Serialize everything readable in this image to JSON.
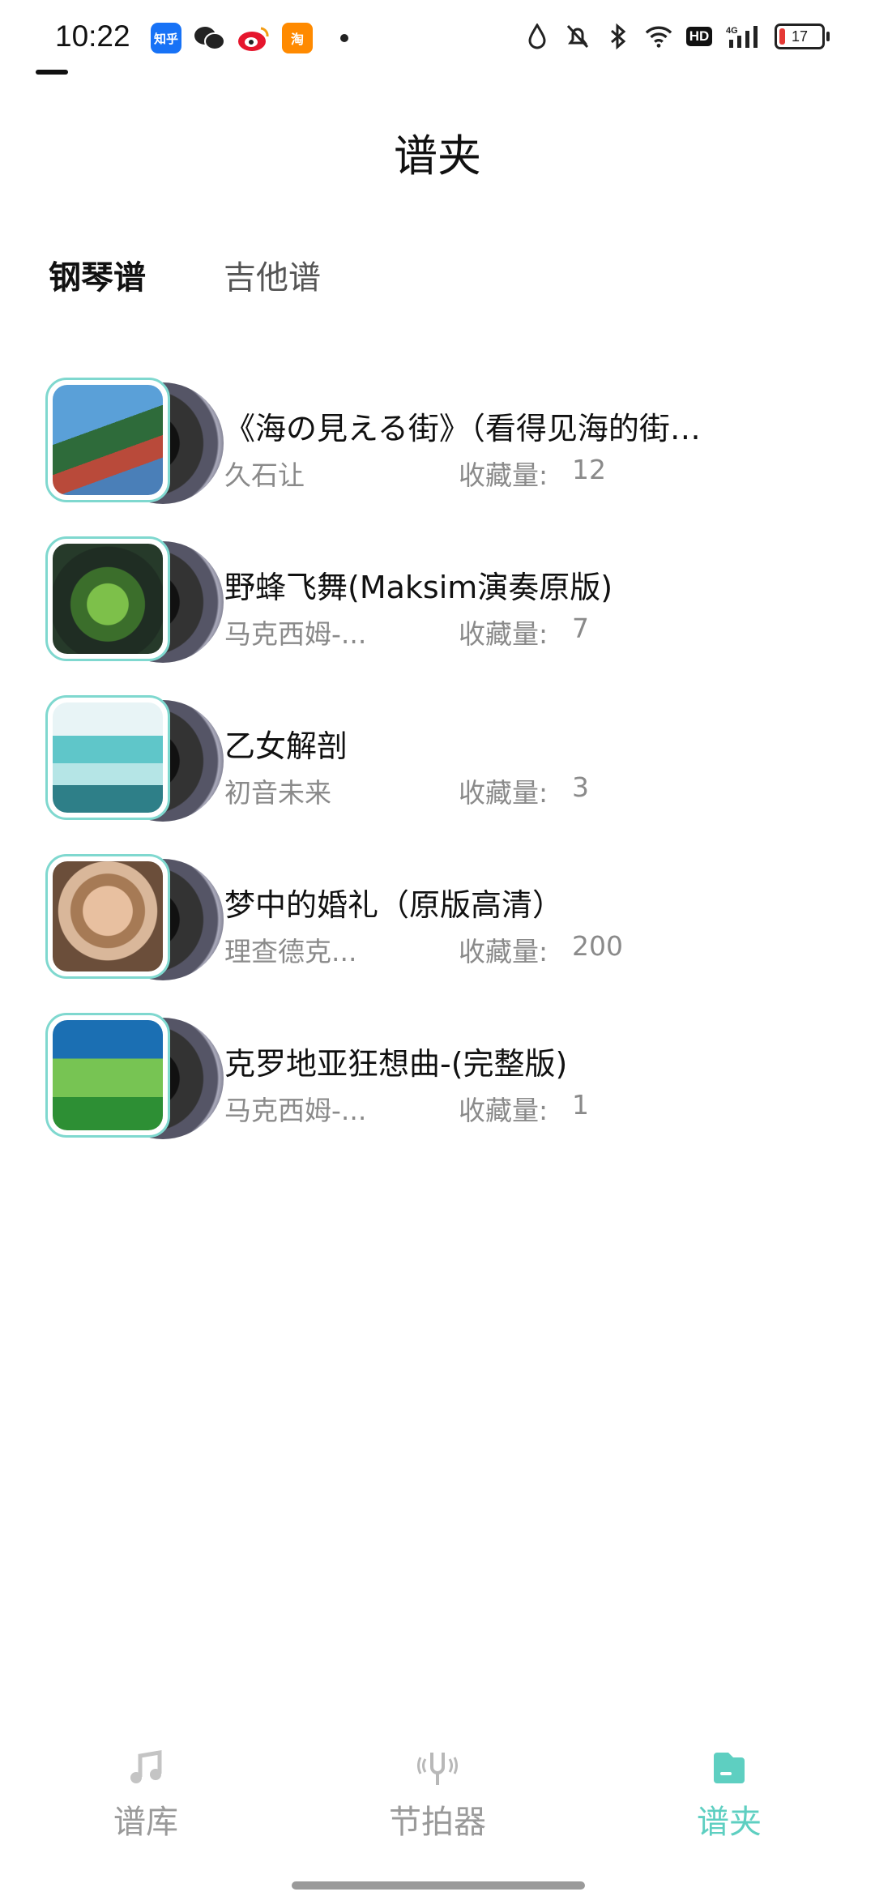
{
  "status_bar": {
    "time": "10:22",
    "apps": [
      "知乎",
      "微信",
      "微博",
      "淘宝"
    ],
    "zhihu_label": "知乎",
    "taobao_label": "淘",
    "hd_label": "HD",
    "network_label": "4G",
    "battery_level": "17"
  },
  "header": {
    "title": "谱夹"
  },
  "tabs": [
    {
      "label": "钢琴谱",
      "active": true
    },
    {
      "label": "吉他谱",
      "active": false
    }
  ],
  "favorites_label": "收藏量:",
  "items": [
    {
      "title": "《海の見える街》（看得见海的街…",
      "artist": "久石让",
      "count": "12"
    },
    {
      "title": "野蜂飞舞(Maksim演奏原版)",
      "artist": "马克西姆-...",
      "count": "7"
    },
    {
      "title": "乙女解剖",
      "artist": "初音未来",
      "count": "3"
    },
    {
      "title": "梦中的婚礼（原版高清）",
      "artist": "理查德克...",
      "count": "200"
    },
    {
      "title": "克罗地亚狂想曲-(完整版)",
      "artist": "马克西姆-...",
      "count": "1"
    }
  ],
  "bottom_nav": [
    {
      "label": "谱库",
      "icon": "music-note-icon",
      "active": false
    },
    {
      "label": "节拍器",
      "icon": "tuning-fork-icon",
      "active": false
    },
    {
      "label": "谱夹",
      "icon": "folder-icon",
      "active": true
    }
  ],
  "colors": {
    "accent": "#5ecfc1",
    "inactive": "#9a9a9a",
    "text": "#111111"
  }
}
